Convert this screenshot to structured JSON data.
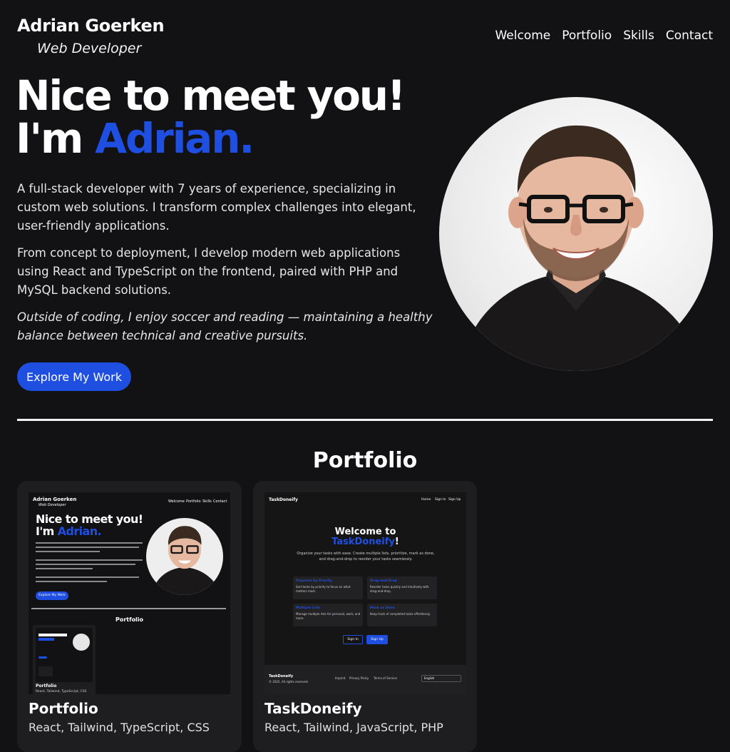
{
  "header": {
    "name": "Adrian Goerken",
    "role": "Web Developer",
    "nav": [
      "Welcome",
      "Portfolio",
      "Skills",
      "Contact"
    ]
  },
  "hero": {
    "line1": "Nice to meet you!",
    "line2_prefix": "I'm ",
    "line2_accent": "Adrian.",
    "bio1": "A full-stack developer with 7 years of experience, specializing in custom web solutions. I transform complex challenges into elegant, user-friendly applications.",
    "bio2": "From concept to deployment, I develop modern web applications using React and TypeScript on the frontend, paired with PHP and MySQL backend solutions.",
    "bio3": "Outside of coding, I enjoy soccer and reading — maintaining a healthy balance between technical and creative pursuits.",
    "cta": "Explore My Work"
  },
  "portfolio": {
    "title": "Portfolio",
    "projects": [
      {
        "title": "Portfolio",
        "tags": "React, Tailwind, TypeScript, CSS",
        "preview": {
          "name": "Adrian Goerken",
          "role": "Web Developer",
          "nav": [
            "Welcome",
            "Portfolio",
            "Skills",
            "Contact"
          ],
          "line1": "Nice to meet you!",
          "line2_prefix": "I'm ",
          "line2_accent": "Adrian.",
          "cta": "Explore My Work",
          "section": "Portfolio",
          "inner_title": "Portfolio",
          "inner_tags": "React, Tailwind, TypeScript, CSS"
        }
      },
      {
        "title": "TaskDoneify",
        "tags": "React, Tailwind, JavaScript, PHP",
        "preview": {
          "brand": "TaskDoneify",
          "nav": [
            "Home",
            "Sign In",
            "Sign Up"
          ],
          "welcome": "Welcome to",
          "app": "TaskDoneify",
          "bang": "!",
          "subtitle": "Organize your tasks with ease. Create multiple lists, prioritize, mark as done, and drag-and-drop to reorder your tasks seamlessly.",
          "features": [
            {
              "title": "Organize by Priority",
              "text": "Sort tasks by priority to focus on what matters most."
            },
            {
              "title": "Drag-and-Drop",
              "text": "Reorder tasks quickly and intuitively with drag-and-drop."
            },
            {
              "title": "Multiple Lists",
              "text": "Manage multiple lists for personal, work, and more."
            },
            {
              "title": "Mark as Done",
              "text": "Keep track of completed tasks effortlessly."
            }
          ],
          "sign_in": "Sign In",
          "sign_up": "Sign Up",
          "footer_brand": "TaskDoneify",
          "footer_copy": "© 2025, All rights reserved.",
          "footer_links": [
            "Imprint",
            "Privacy Policy",
            "Terms of Service"
          ],
          "language": "English"
        }
      }
    ]
  },
  "colors": {
    "background": "#121113",
    "accent": "#1f4fe0",
    "card": "#1e1d20"
  }
}
